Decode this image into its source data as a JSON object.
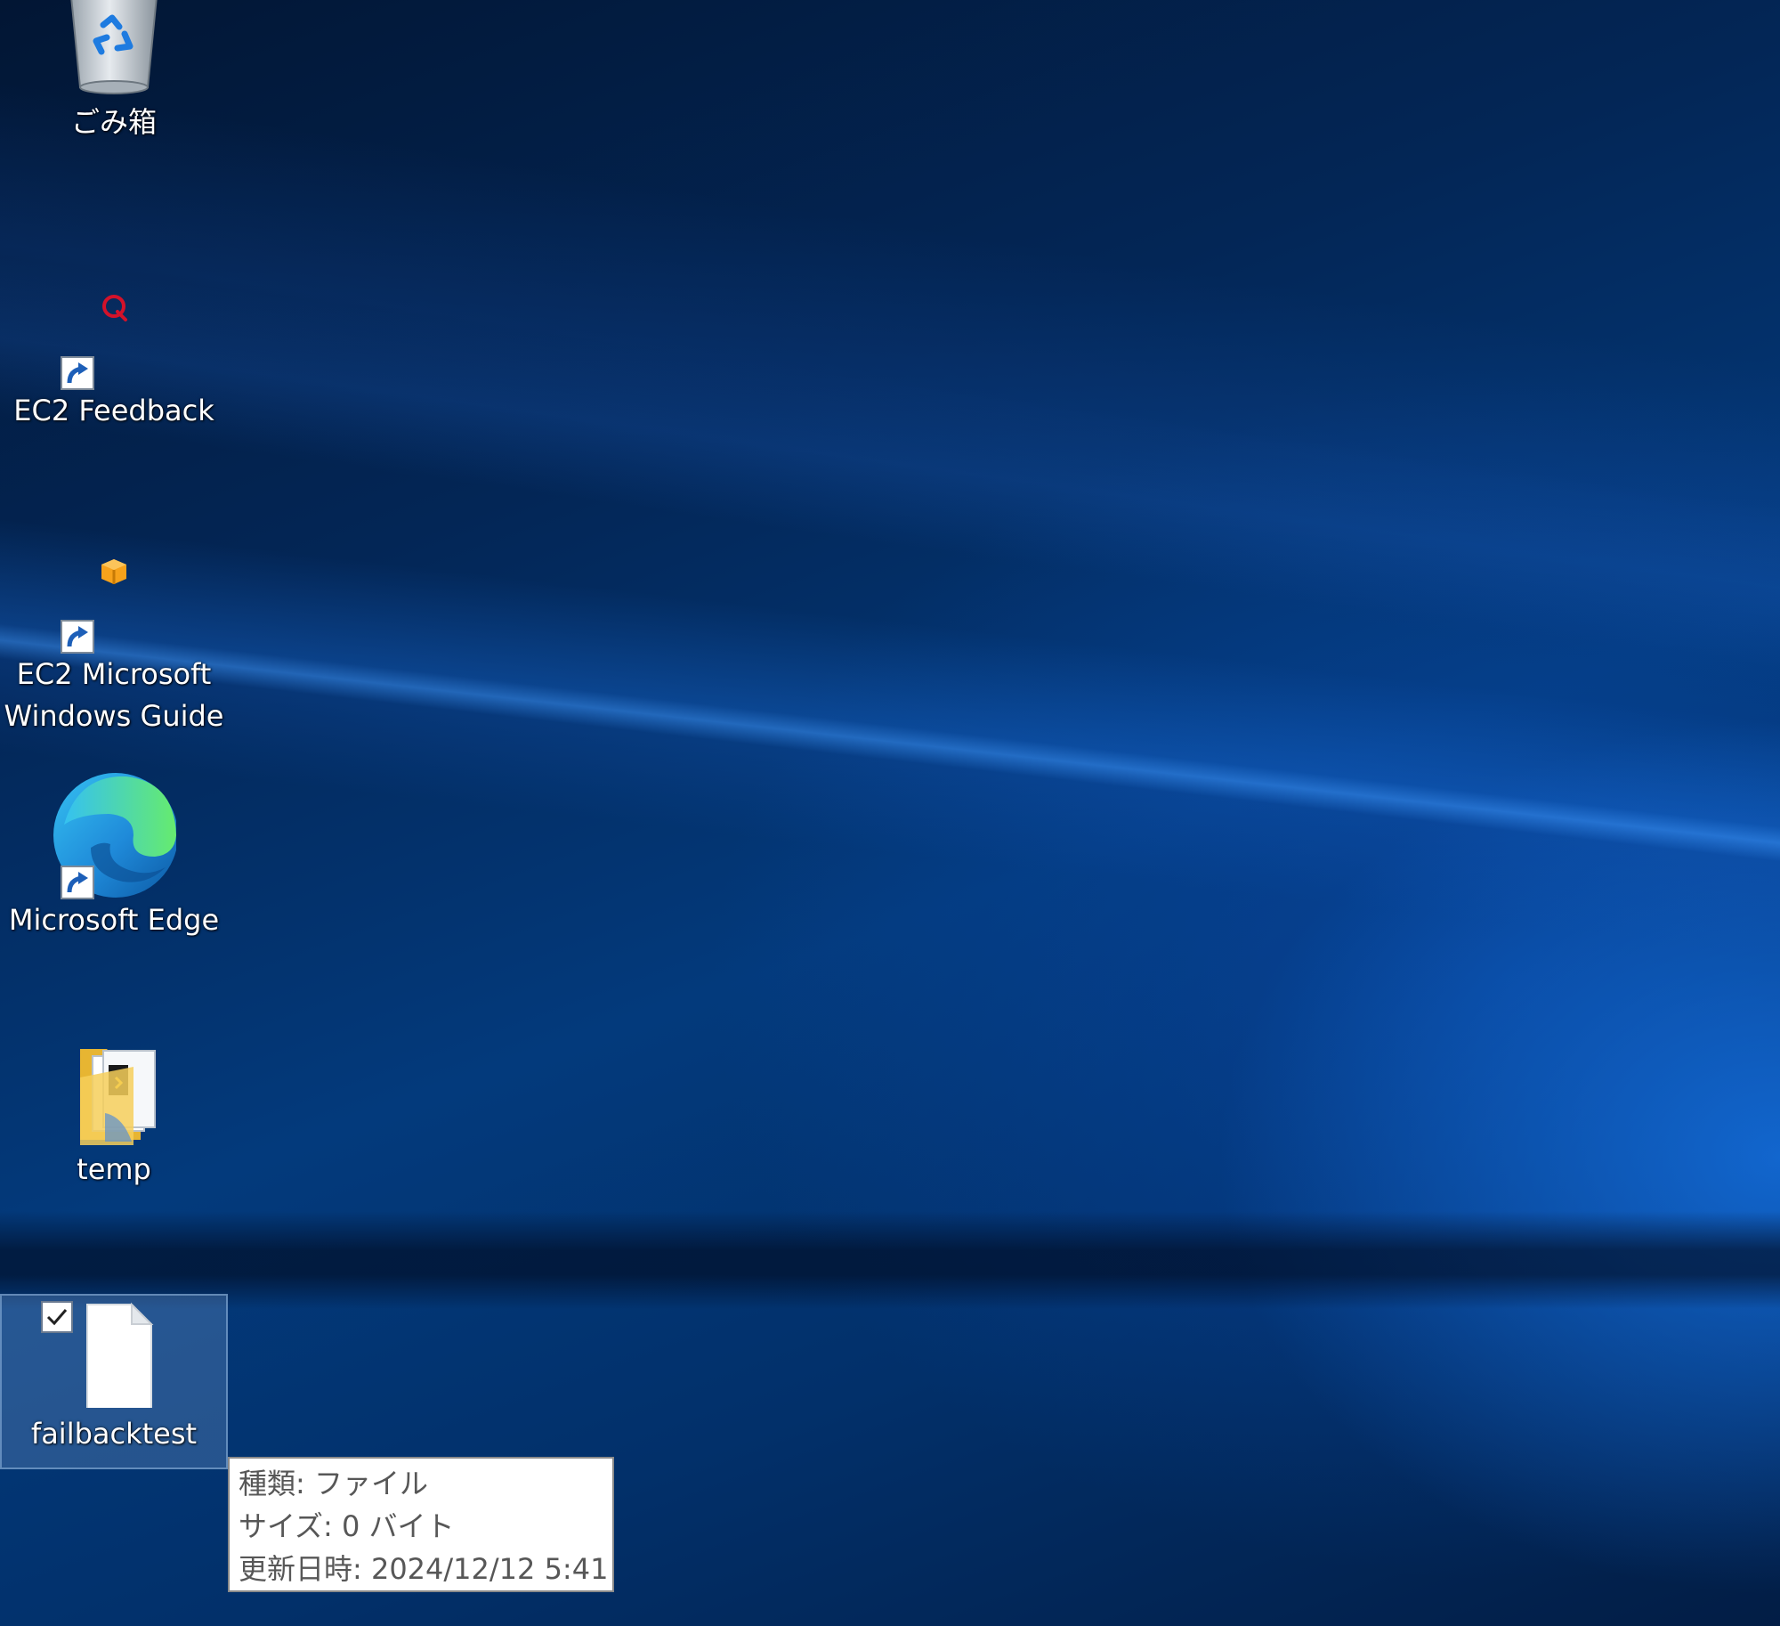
{
  "desktop": {
    "icons": [
      {
        "label": "ごみ箱",
        "icon": "recycle-bin-icon",
        "shortcut": false
      },
      {
        "label": "EC2 Feedback",
        "icon": "ec2-feedback-icon",
        "shortcut": true
      },
      {
        "label_lines": [
          "EC2 Microsoft",
          "Windows Guide"
        ],
        "icon": "aws-package-icon",
        "shortcut": true
      },
      {
        "label": "Microsoft Edge",
        "icon": "edge-icon",
        "shortcut": true
      },
      {
        "label": "temp",
        "icon": "folder-icon",
        "shortcut": false
      },
      {
        "label": "failbacktest",
        "icon": "file-icon",
        "shortcut": false,
        "selected": true
      }
    ]
  },
  "tooltip": {
    "lines": [
      "種類: ファイル",
      "サイズ: 0 バイト",
      "更新日時: 2024/12/12 5:41"
    ]
  },
  "colors": {
    "selection": "#78a0d2",
    "wallpaper_accent": "#1a6fd6",
    "tooltip_text": "#575757"
  }
}
